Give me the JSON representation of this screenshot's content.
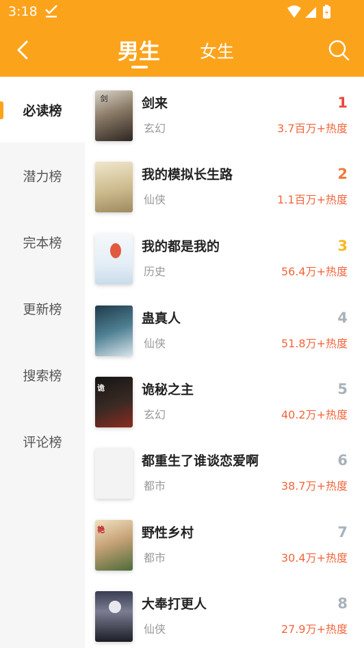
{
  "status": {
    "time": "3:18"
  },
  "header": {
    "tabs": [
      {
        "label": "男生"
      },
      {
        "label": "女生"
      }
    ]
  },
  "sidebar": {
    "items": [
      {
        "label": "必读榜"
      },
      {
        "label": "潜力榜"
      },
      {
        "label": "完本榜"
      },
      {
        "label": "更新榜"
      },
      {
        "label": "搜索榜"
      },
      {
        "label": "评论榜"
      }
    ]
  },
  "colors": {
    "accent": "#FCA31C",
    "heat": "#F2643B",
    "rank_1": "#E8483B",
    "rank_2": "#F2793B",
    "rank_3": "#F6B91E",
    "rank_other": "#A9B2BA"
  },
  "books": [
    {
      "rank": "1",
      "title": "剑来",
      "genre": "玄幻",
      "heat": "3.7百万+热度"
    },
    {
      "rank": "2",
      "title": "我的模拟长生路",
      "genre": "仙侠",
      "heat": "1.1百万+热度"
    },
    {
      "rank": "3",
      "title": "我的都是我的",
      "genre": "历史",
      "heat": "56.4万+热度"
    },
    {
      "rank": "4",
      "title": "蛊真人",
      "genre": "仙侠",
      "heat": "51.8万+热度"
    },
    {
      "rank": "5",
      "title": "诡秘之主",
      "genre": "玄幻",
      "heat": "40.2万+热度"
    },
    {
      "rank": "6",
      "title": "都重生了谁谈恋爱啊",
      "genre": "都市",
      "heat": "38.7万+热度"
    },
    {
      "rank": "7",
      "title": "野性乡村",
      "genre": "都市",
      "heat": "30.4万+热度"
    },
    {
      "rank": "8",
      "title": "大奉打更人",
      "genre": "仙侠",
      "heat": "27.9万+热度"
    }
  ]
}
